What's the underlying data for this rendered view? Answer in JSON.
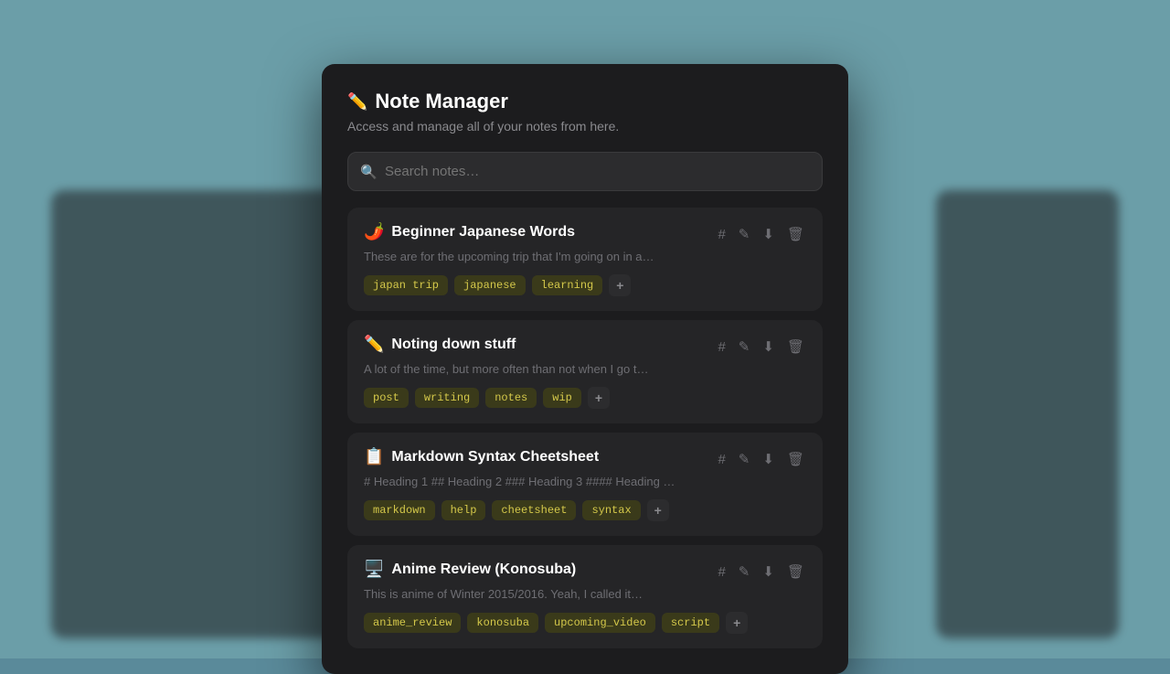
{
  "app": {
    "title": "Note Manager",
    "title_icon": "✏️",
    "subtitle": "Access and manage all of your notes from here."
  },
  "search": {
    "placeholder": "Search notes…"
  },
  "notes": [
    {
      "id": "note-1",
      "emoji": "🌶️",
      "title": "Beginner Japanese Words",
      "preview": "These are for the upcoming trip that I'm going on in a…",
      "tags": [
        "japan trip",
        "japanese",
        "learning"
      ],
      "has_add": true
    },
    {
      "id": "note-2",
      "emoji": "✏️",
      "title": "Noting down stuff",
      "preview": "A lot of the time, but more often than not when I go t…",
      "tags": [
        "post",
        "writing",
        "notes",
        "wip"
      ],
      "has_add": true
    },
    {
      "id": "note-3",
      "emoji": "📋",
      "title": "Markdown Syntax Cheetsheet",
      "preview": "# Heading 1 ## Heading 2 ### Heading 3 #### Heading …",
      "tags": [
        "markdown",
        "help",
        "cheetsheet",
        "syntax"
      ],
      "has_add": true
    },
    {
      "id": "note-4",
      "emoji": "🖥️",
      "title": "Anime Review (Konosuba)",
      "preview": "This is anime of Winter 2015/2016. Yeah, I called it…",
      "tags": [
        "anime_review",
        "konosuba",
        "upcoming_video",
        "script"
      ],
      "has_add": true
    }
  ],
  "actions": {
    "hash": "#",
    "edit": "✎",
    "download": "↓",
    "delete": "🗑",
    "add": "+"
  }
}
